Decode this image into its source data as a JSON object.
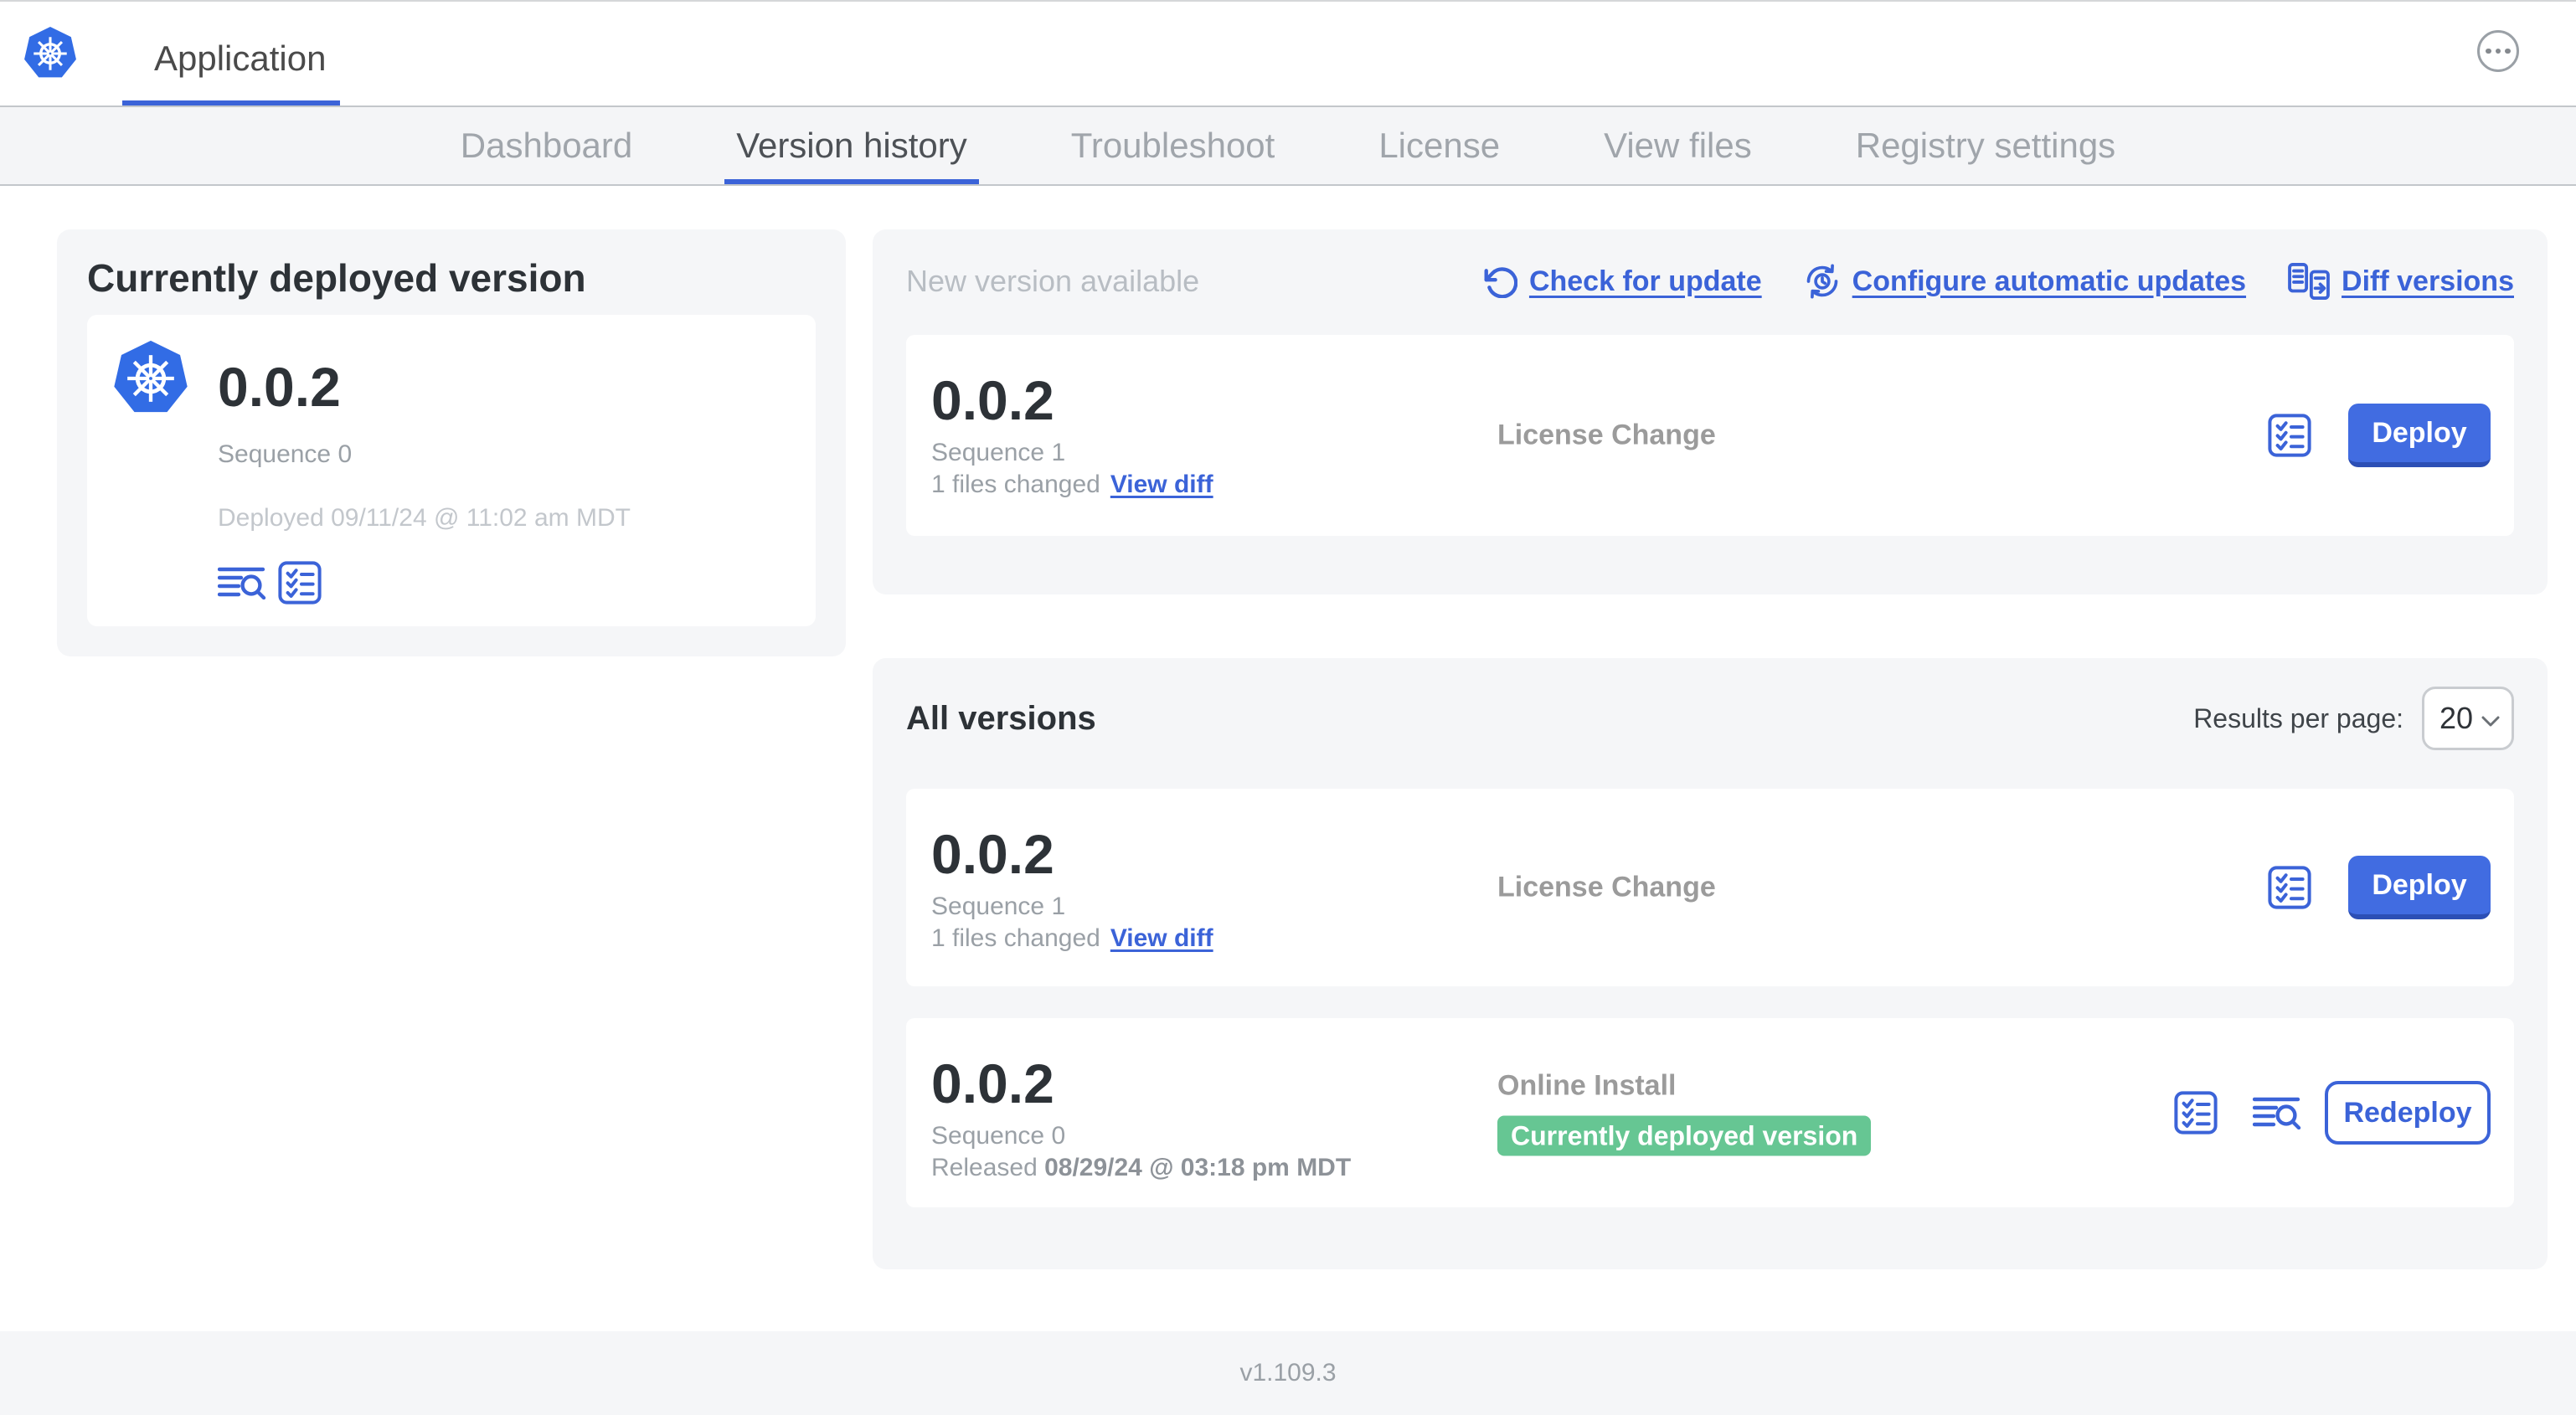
{
  "header": {
    "app_title": "Application"
  },
  "nav": {
    "tabs": [
      {
        "label": "Dashboard",
        "active": false
      },
      {
        "label": "Version history",
        "active": true
      },
      {
        "label": "Troubleshoot",
        "active": false
      },
      {
        "label": "License",
        "active": false
      },
      {
        "label": "View files",
        "active": false
      },
      {
        "label": "Registry settings",
        "active": false
      }
    ]
  },
  "current_version_panel": {
    "heading": "Currently deployed version",
    "version": "0.0.2",
    "sequence": "Sequence 0",
    "deployed": "Deployed 09/11/24 @ 11:02 am MDT"
  },
  "new_version_panel": {
    "title": "New version available",
    "check_for_update": "Check for update",
    "configure_updates": "Configure automatic updates",
    "diff_versions": "Diff versions",
    "row": {
      "version": "0.0.2",
      "sequence": "Sequence 1",
      "files_changed": "1 files changed",
      "view_diff": "View diff",
      "source": "License Change",
      "action": "Deploy"
    }
  },
  "all_versions_panel": {
    "title": "All versions",
    "results_per_page_label": "Results per page:",
    "page_size": "20",
    "rows": [
      {
        "version": "0.0.2",
        "sequence": "Sequence 1",
        "files_changed": "1 files changed",
        "view_diff": "View diff",
        "source": "License Change",
        "action": "Deploy"
      },
      {
        "version": "0.0.2",
        "sequence": "Sequence 0",
        "released_prefix": "Released ",
        "released_date": "08/29/24 @ 03:18 pm MDT",
        "source": "Online Install",
        "badge": "Currently deployed version",
        "action": "Redeploy"
      }
    ]
  },
  "footer": {
    "app_version": "v1.109.3"
  },
  "colors": {
    "accent_blue": "#3b63d8",
    "button_blue": "#416ce1",
    "logo_blue": "#326ce5",
    "badge_green": "#66c693",
    "panel_gray": "#f5f6f8"
  }
}
